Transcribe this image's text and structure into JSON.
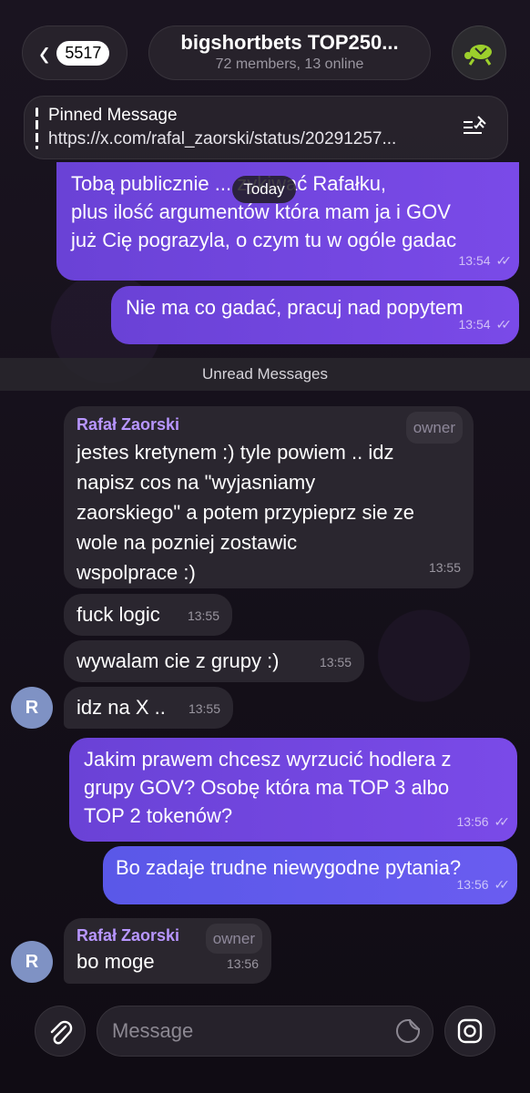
{
  "header": {
    "back_count": "5517",
    "title": "bigshortbets TOP250...",
    "subtitle": "72 members, 13 online"
  },
  "pinned": {
    "title": "Pinned Message",
    "text": "https://x.com/rafal_zaorski/status/20291257..."
  },
  "date_badge": "Today",
  "unread_label": "Unread Messages",
  "messages": [
    {
      "text_lines": [
        "Tobą publicznie ... zykiwać Rafałku,",
        "plus ilość argumentów która mam ja i GOV",
        "już Cię pograzyla, o czym tu w ogóle gadac"
      ],
      "time": "13:54"
    },
    {
      "text": "Nie ma co gadać, pracuj nad popytem",
      "time": "13:54"
    },
    {
      "sender": "Rafał Zaorski",
      "role": "owner",
      "text_lines": [
        "jestes kretynem :) tyle powiem .. idz",
        "napisz cos na \"wyjasniamy",
        "zaorskiego\" a potem przypieprz sie ze",
        "wole na pozniej zostawic",
        "wspolprace :)"
      ],
      "time": "13:55"
    },
    {
      "text": "fuck logic",
      "time": "13:55"
    },
    {
      "text": "wywalam cie z grupy :)",
      "time": "13:55"
    },
    {
      "text": "idz na X ..",
      "time": "13:55"
    },
    {
      "text_lines": [
        "Jakim prawem chcesz wyrzucić hodlera z",
        "grupy GOV? Osobę która ma TOP 3 albo",
        "TOP 2 tokenów?"
      ],
      "time": "13:56"
    },
    {
      "text": "Bo zadaje trudne niewygodne pytania?",
      "time": "13:56"
    },
    {
      "sender": "Rafał Zaorski",
      "role": "owner",
      "text": "bo moge",
      "time": "13:56"
    }
  ],
  "avatar_letter": "R",
  "input": {
    "placeholder": "Message"
  },
  "colors": {
    "outgoing": "#7044dc",
    "incoming": "#2c2830",
    "sender": "#b896ff"
  }
}
